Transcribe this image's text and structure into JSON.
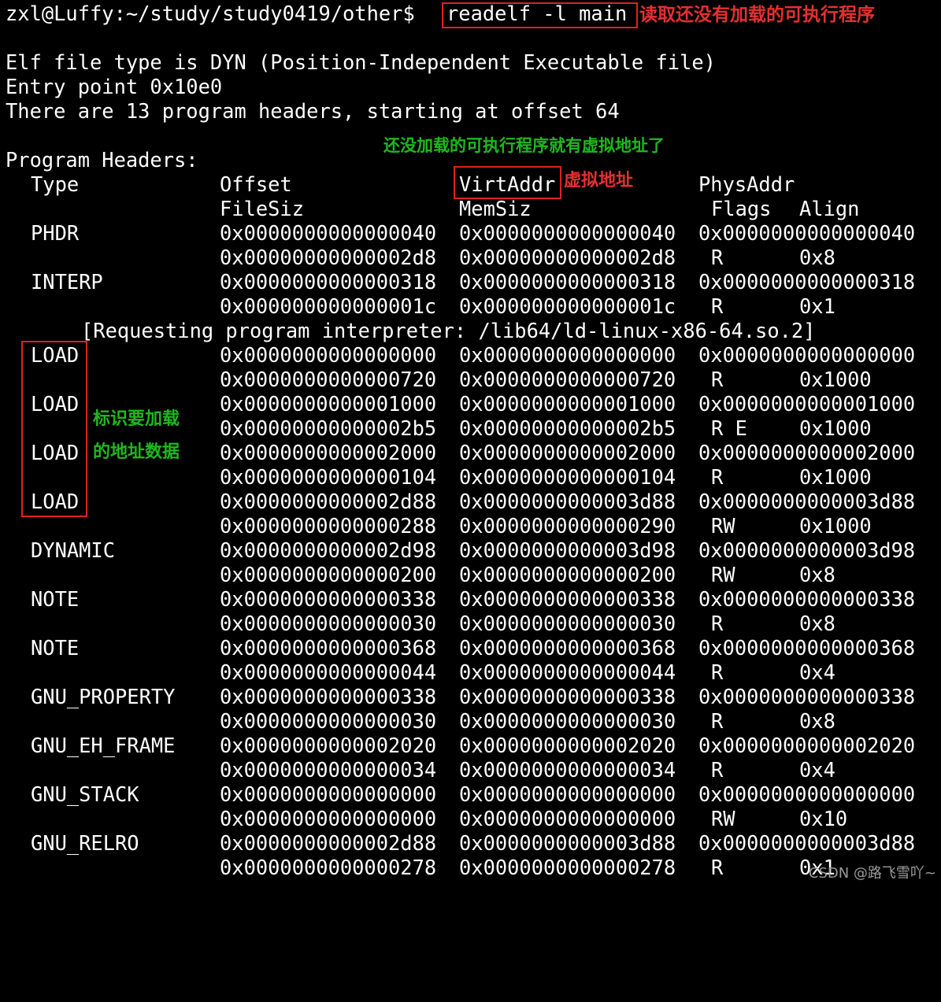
{
  "terminal": {
    "prompt": "zxl@Luffy:~/study/study0419/other$ ",
    "command": "readelf -l main",
    "info_lines": [
      "Elf file type is DYN (Position-Independent Executable file)",
      "Entry point 0x10e0",
      "There are 13 program headers, starting at offset 64"
    ],
    "section_title": "Program Headers:",
    "header": {
      "type": "Type",
      "offset": "Offset",
      "virtaddr": "VirtAddr",
      "physaddr": "PhysAddr",
      "filesiz": "FileSiz",
      "memsiz": "MemSiz",
      "flags": "Flags",
      "align": "Align"
    },
    "interp_note": "[Requesting program interpreter: /lib64/ld-linux-x86-64.so.2]",
    "rows": [
      {
        "type": "PHDR",
        "offset": "0x0000000000000040",
        "virtaddr": "0x0000000000000040",
        "physaddr": "0x0000000000000040",
        "filesiz": "0x00000000000002d8",
        "memsiz": "0x00000000000002d8",
        "flags": "R",
        "align": "0x8"
      },
      {
        "type": "INTERP",
        "offset": "0x0000000000000318",
        "virtaddr": "0x0000000000000318",
        "physaddr": "0x0000000000000318",
        "filesiz": "0x000000000000001c",
        "memsiz": "0x000000000000001c",
        "flags": "R",
        "align": "0x1"
      },
      {
        "type": "LOAD",
        "offset": "0x0000000000000000",
        "virtaddr": "0x0000000000000000",
        "physaddr": "0x0000000000000000",
        "filesiz": "0x0000000000000720",
        "memsiz": "0x0000000000000720",
        "flags": "R",
        "align": "0x1000"
      },
      {
        "type": "LOAD",
        "offset": "0x0000000000001000",
        "virtaddr": "0x0000000000001000",
        "physaddr": "0x0000000000001000",
        "filesiz": "0x00000000000002b5",
        "memsiz": "0x00000000000002b5",
        "flags": "R E",
        "align": "0x1000"
      },
      {
        "type": "LOAD",
        "offset": "0x0000000000002000",
        "virtaddr": "0x0000000000002000",
        "physaddr": "0x0000000000002000",
        "filesiz": "0x0000000000000104",
        "memsiz": "0x0000000000000104",
        "flags": "R",
        "align": "0x1000"
      },
      {
        "type": "LOAD",
        "offset": "0x0000000000002d88",
        "virtaddr": "0x0000000000003d88",
        "physaddr": "0x0000000000003d88",
        "filesiz": "0x0000000000000288",
        "memsiz": "0x0000000000000290",
        "flags": "RW",
        "align": "0x1000"
      },
      {
        "type": "DYNAMIC",
        "offset": "0x0000000000002d98",
        "virtaddr": "0x0000000000003d98",
        "physaddr": "0x0000000000003d98",
        "filesiz": "0x0000000000000200",
        "memsiz": "0x0000000000000200",
        "flags": "RW",
        "align": "0x8"
      },
      {
        "type": "NOTE",
        "offset": "0x0000000000000338",
        "virtaddr": "0x0000000000000338",
        "physaddr": "0x0000000000000338",
        "filesiz": "0x0000000000000030",
        "memsiz": "0x0000000000000030",
        "flags": "R",
        "align": "0x8"
      },
      {
        "type": "NOTE",
        "offset": "0x0000000000000368",
        "virtaddr": "0x0000000000000368",
        "physaddr": "0x0000000000000368",
        "filesiz": "0x0000000000000044",
        "memsiz": "0x0000000000000044",
        "flags": "R",
        "align": "0x4"
      },
      {
        "type": "GNU_PROPERTY",
        "offset": "0x0000000000000338",
        "virtaddr": "0x0000000000000338",
        "physaddr": "0x0000000000000338",
        "filesiz": "0x0000000000000030",
        "memsiz": "0x0000000000000030",
        "flags": "R",
        "align": "0x8"
      },
      {
        "type": "GNU_EH_FRAME",
        "offset": "0x0000000000002020",
        "virtaddr": "0x0000000000002020",
        "physaddr": "0x0000000000002020",
        "filesiz": "0x0000000000000034",
        "memsiz": "0x0000000000000034",
        "flags": "R",
        "align": "0x4"
      },
      {
        "type": "GNU_STACK",
        "offset": "0x0000000000000000",
        "virtaddr": "0x0000000000000000",
        "physaddr": "0x0000000000000000",
        "filesiz": "0x0000000000000000",
        "memsiz": "0x0000000000000000",
        "flags": "RW",
        "align": "0x10"
      },
      {
        "type": "GNU_RELRO",
        "offset": "0x0000000000002d88",
        "virtaddr": "0x0000000000003d88",
        "physaddr": "0x0000000000003d88",
        "filesiz": "0x0000000000000278",
        "memsiz": "0x0000000000000278",
        "flags": "R",
        "align": "0x1"
      }
    ]
  },
  "annotations": {
    "command_note": "读取还没有加载的可执行程序",
    "virtaddr_note": "还没加载的可执行程序就有虚拟地址了",
    "virtaddr_label": "虚拟地址",
    "load_note_line1": "标识要加载",
    "load_note_line2": "的地址数据"
  },
  "watermark": "CSDN @路飞雪吖~",
  "colors": {
    "background": "#000000",
    "text": "#ffffff",
    "highlight_box": "#e02020",
    "red_annotation": "#e53030",
    "green_annotation": "#1fb81f"
  }
}
